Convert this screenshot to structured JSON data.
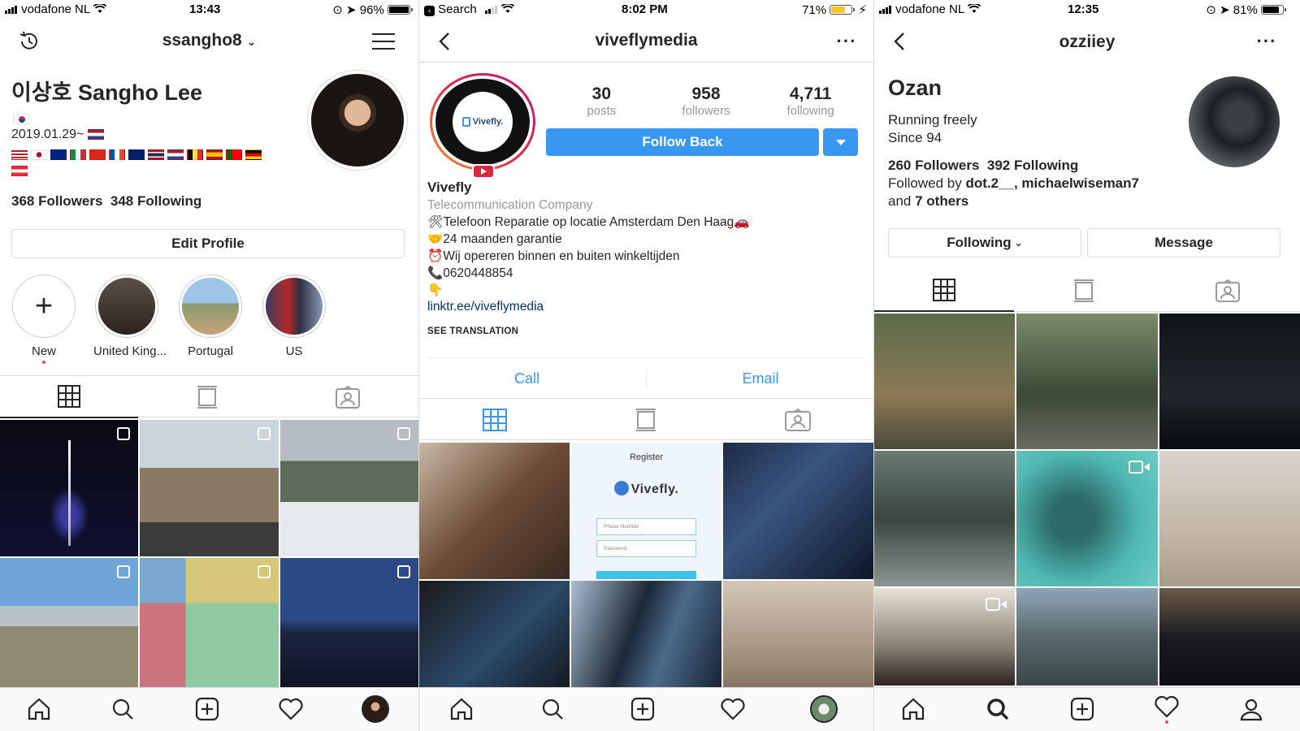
{
  "panel1": {
    "status": {
      "carrier": "vodafone NL",
      "time": "13:43",
      "battery": "96%"
    },
    "username": "ssangho8",
    "display_name": "이상호 Sangho Lee",
    "bio_date": "2019.01.29~",
    "followers": "368 Followers",
    "following": "348 Following",
    "edit_profile": "Edit Profile",
    "highlights": [
      {
        "label": "New"
      },
      {
        "label": "United King..."
      },
      {
        "label": "Portugal"
      },
      {
        "label": "US"
      }
    ]
  },
  "panel2": {
    "status": {
      "back_app": "Search",
      "time": "8:02 PM",
      "battery": "71%"
    },
    "username": "viveflymedia",
    "stats": [
      {
        "num": "30",
        "label": "posts"
      },
      {
        "num": "958",
        "label": "followers"
      },
      {
        "num": "4,711",
        "label": "following"
      }
    ],
    "follow_back": "Follow Back",
    "logo_text": "Vivefly.",
    "name": "Vivefly",
    "category": "Telecommunication Company",
    "bio": [
      "🛠Telefoon Reparatie op locatie Amsterdam Den Haag🚗",
      "🤝24 maanden garantie",
      "⏰Wij opereren binnen en buiten winkeltijden",
      "📞0620448854",
      "👇"
    ],
    "link": "linktr.ee/viveflymedia",
    "see_translation": "SEE TRANSLATION",
    "call": "Call",
    "email": "Email",
    "register_post": {
      "title": "Register",
      "brand": "Vivefly.",
      "phone_placeholder": "Phone Number",
      "password_placeholder": "Password"
    }
  },
  "panel3": {
    "status": {
      "carrier": "vodafone NL",
      "time": "12:35",
      "battery": "81%"
    },
    "username": "ozziiey",
    "name": "Ozan",
    "bio1": "Running freely",
    "bio2": "Since 94",
    "followers": "260 Followers",
    "following": "392 Following",
    "followed_prefix": "Followed by ",
    "followed_names": "dot.2__, michaelwiseman7",
    "followed_and": "and ",
    "followed_others": "7 others",
    "following_btn": "Following",
    "message_btn": "Message"
  },
  "colors": {
    "instagram_blue": "#3897f0",
    "link_blue": "#003569",
    "muted_gray": "#999999",
    "border": "#dbdbdb",
    "notification_red": "#ed4956"
  }
}
